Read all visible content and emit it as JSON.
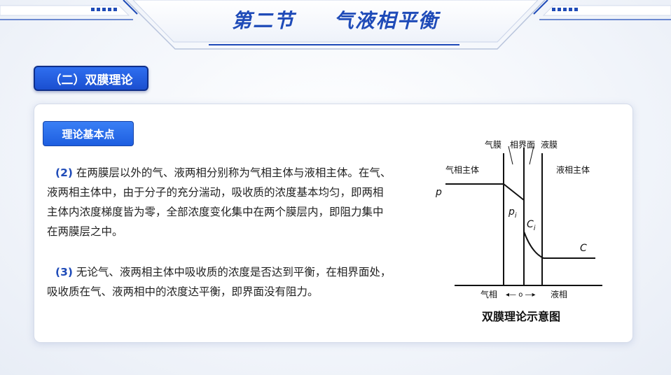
{
  "header": {
    "section": "第二节",
    "topic": "气液相平衡"
  },
  "section_badge": "（二）双膜理论",
  "panel": {
    "subtitle": "理论基本点",
    "paragraphs": [
      {
        "number": "(2)",
        "text": "在两膜层以外的气、液两相分别称为气相主体与液相主体。在气、液两相主体中，由于分子的充分湍动，吸收质的浓度基本均匀，即两相主体内浓度梯度皆为零，全部浓度变化集中在两个膜层内，即阻力集中在两膜层之中。"
      },
      {
        "number": "(3)",
        "text": "无论气、液两相主体中吸收质的浓度是否达到平衡，在相界面处，吸收质在气、液两相中的浓度达平衡，即界面没有阻力。"
      }
    ]
  },
  "diagram": {
    "caption": "双膜理论示意图",
    "labels": {
      "gas_film": "气膜",
      "interface": "相界面",
      "liquid_film": "液膜",
      "gas_bulk": "气相主体",
      "liquid_bulk": "液相主体",
      "p": "p",
      "pi": "p",
      "pi_sub": "i",
      "ci": "C",
      "ci_sub": "i",
      "c": "C",
      "gas_phase": "气相",
      "liquid_phase": "液相",
      "arrows": "◂— o —▸"
    }
  }
}
